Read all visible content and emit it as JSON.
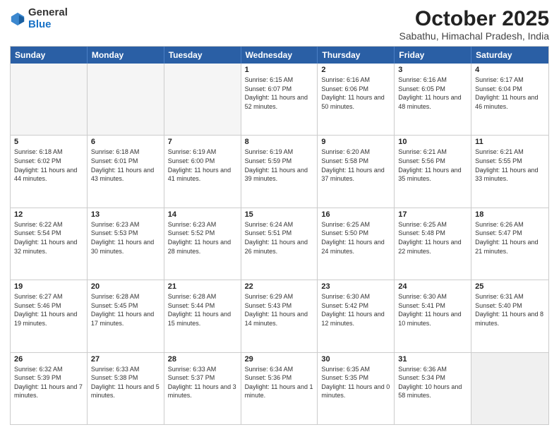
{
  "logo": {
    "general": "General",
    "blue": "Blue"
  },
  "title": "October 2025",
  "location": "Sabathu, Himachal Pradesh, India",
  "weekdays": [
    "Sunday",
    "Monday",
    "Tuesday",
    "Wednesday",
    "Thursday",
    "Friday",
    "Saturday"
  ],
  "weeks": [
    [
      {
        "day": "",
        "sunrise": "",
        "sunset": "",
        "daylight": "",
        "empty": true
      },
      {
        "day": "",
        "sunrise": "",
        "sunset": "",
        "daylight": "",
        "empty": true
      },
      {
        "day": "",
        "sunrise": "",
        "sunset": "",
        "daylight": "",
        "empty": true
      },
      {
        "day": "1",
        "sunrise": "Sunrise: 6:15 AM",
        "sunset": "Sunset: 6:07 PM",
        "daylight": "Daylight: 11 hours and 52 minutes."
      },
      {
        "day": "2",
        "sunrise": "Sunrise: 6:16 AM",
        "sunset": "Sunset: 6:06 PM",
        "daylight": "Daylight: 11 hours and 50 minutes."
      },
      {
        "day": "3",
        "sunrise": "Sunrise: 6:16 AM",
        "sunset": "Sunset: 6:05 PM",
        "daylight": "Daylight: 11 hours and 48 minutes."
      },
      {
        "day": "4",
        "sunrise": "Sunrise: 6:17 AM",
        "sunset": "Sunset: 6:04 PM",
        "daylight": "Daylight: 11 hours and 46 minutes."
      }
    ],
    [
      {
        "day": "5",
        "sunrise": "Sunrise: 6:18 AM",
        "sunset": "Sunset: 6:02 PM",
        "daylight": "Daylight: 11 hours and 44 minutes."
      },
      {
        "day": "6",
        "sunrise": "Sunrise: 6:18 AM",
        "sunset": "Sunset: 6:01 PM",
        "daylight": "Daylight: 11 hours and 43 minutes."
      },
      {
        "day": "7",
        "sunrise": "Sunrise: 6:19 AM",
        "sunset": "Sunset: 6:00 PM",
        "daylight": "Daylight: 11 hours and 41 minutes."
      },
      {
        "day": "8",
        "sunrise": "Sunrise: 6:19 AM",
        "sunset": "Sunset: 5:59 PM",
        "daylight": "Daylight: 11 hours and 39 minutes."
      },
      {
        "day": "9",
        "sunrise": "Sunrise: 6:20 AM",
        "sunset": "Sunset: 5:58 PM",
        "daylight": "Daylight: 11 hours and 37 minutes."
      },
      {
        "day": "10",
        "sunrise": "Sunrise: 6:21 AM",
        "sunset": "Sunset: 5:56 PM",
        "daylight": "Daylight: 11 hours and 35 minutes."
      },
      {
        "day": "11",
        "sunrise": "Sunrise: 6:21 AM",
        "sunset": "Sunset: 5:55 PM",
        "daylight": "Daylight: 11 hours and 33 minutes."
      }
    ],
    [
      {
        "day": "12",
        "sunrise": "Sunrise: 6:22 AM",
        "sunset": "Sunset: 5:54 PM",
        "daylight": "Daylight: 11 hours and 32 minutes."
      },
      {
        "day": "13",
        "sunrise": "Sunrise: 6:23 AM",
        "sunset": "Sunset: 5:53 PM",
        "daylight": "Daylight: 11 hours and 30 minutes."
      },
      {
        "day": "14",
        "sunrise": "Sunrise: 6:23 AM",
        "sunset": "Sunset: 5:52 PM",
        "daylight": "Daylight: 11 hours and 28 minutes."
      },
      {
        "day": "15",
        "sunrise": "Sunrise: 6:24 AM",
        "sunset": "Sunset: 5:51 PM",
        "daylight": "Daylight: 11 hours and 26 minutes."
      },
      {
        "day": "16",
        "sunrise": "Sunrise: 6:25 AM",
        "sunset": "Sunset: 5:50 PM",
        "daylight": "Daylight: 11 hours and 24 minutes."
      },
      {
        "day": "17",
        "sunrise": "Sunrise: 6:25 AM",
        "sunset": "Sunset: 5:48 PM",
        "daylight": "Daylight: 11 hours and 22 minutes."
      },
      {
        "day": "18",
        "sunrise": "Sunrise: 6:26 AM",
        "sunset": "Sunset: 5:47 PM",
        "daylight": "Daylight: 11 hours and 21 minutes."
      }
    ],
    [
      {
        "day": "19",
        "sunrise": "Sunrise: 6:27 AM",
        "sunset": "Sunset: 5:46 PM",
        "daylight": "Daylight: 11 hours and 19 minutes."
      },
      {
        "day": "20",
        "sunrise": "Sunrise: 6:28 AM",
        "sunset": "Sunset: 5:45 PM",
        "daylight": "Daylight: 11 hours and 17 minutes."
      },
      {
        "day": "21",
        "sunrise": "Sunrise: 6:28 AM",
        "sunset": "Sunset: 5:44 PM",
        "daylight": "Daylight: 11 hours and 15 minutes."
      },
      {
        "day": "22",
        "sunrise": "Sunrise: 6:29 AM",
        "sunset": "Sunset: 5:43 PM",
        "daylight": "Daylight: 11 hours and 14 minutes."
      },
      {
        "day": "23",
        "sunrise": "Sunrise: 6:30 AM",
        "sunset": "Sunset: 5:42 PM",
        "daylight": "Daylight: 11 hours and 12 minutes."
      },
      {
        "day": "24",
        "sunrise": "Sunrise: 6:30 AM",
        "sunset": "Sunset: 5:41 PM",
        "daylight": "Daylight: 11 hours and 10 minutes."
      },
      {
        "day": "25",
        "sunrise": "Sunrise: 6:31 AM",
        "sunset": "Sunset: 5:40 PM",
        "daylight": "Daylight: 11 hours and 8 minutes."
      }
    ],
    [
      {
        "day": "26",
        "sunrise": "Sunrise: 6:32 AM",
        "sunset": "Sunset: 5:39 PM",
        "daylight": "Daylight: 11 hours and 7 minutes."
      },
      {
        "day": "27",
        "sunrise": "Sunrise: 6:33 AM",
        "sunset": "Sunset: 5:38 PM",
        "daylight": "Daylight: 11 hours and 5 minutes."
      },
      {
        "day": "28",
        "sunrise": "Sunrise: 6:33 AM",
        "sunset": "Sunset: 5:37 PM",
        "daylight": "Daylight: 11 hours and 3 minutes."
      },
      {
        "day": "29",
        "sunrise": "Sunrise: 6:34 AM",
        "sunset": "Sunset: 5:36 PM",
        "daylight": "Daylight: 11 hours and 1 minute."
      },
      {
        "day": "30",
        "sunrise": "Sunrise: 6:35 AM",
        "sunset": "Sunset: 5:35 PM",
        "daylight": "Daylight: 11 hours and 0 minutes."
      },
      {
        "day": "31",
        "sunrise": "Sunrise: 6:36 AM",
        "sunset": "Sunset: 5:34 PM",
        "daylight": "Daylight: 10 hours and 58 minutes."
      },
      {
        "day": "",
        "sunrise": "",
        "sunset": "",
        "daylight": "",
        "empty": true
      }
    ]
  ]
}
